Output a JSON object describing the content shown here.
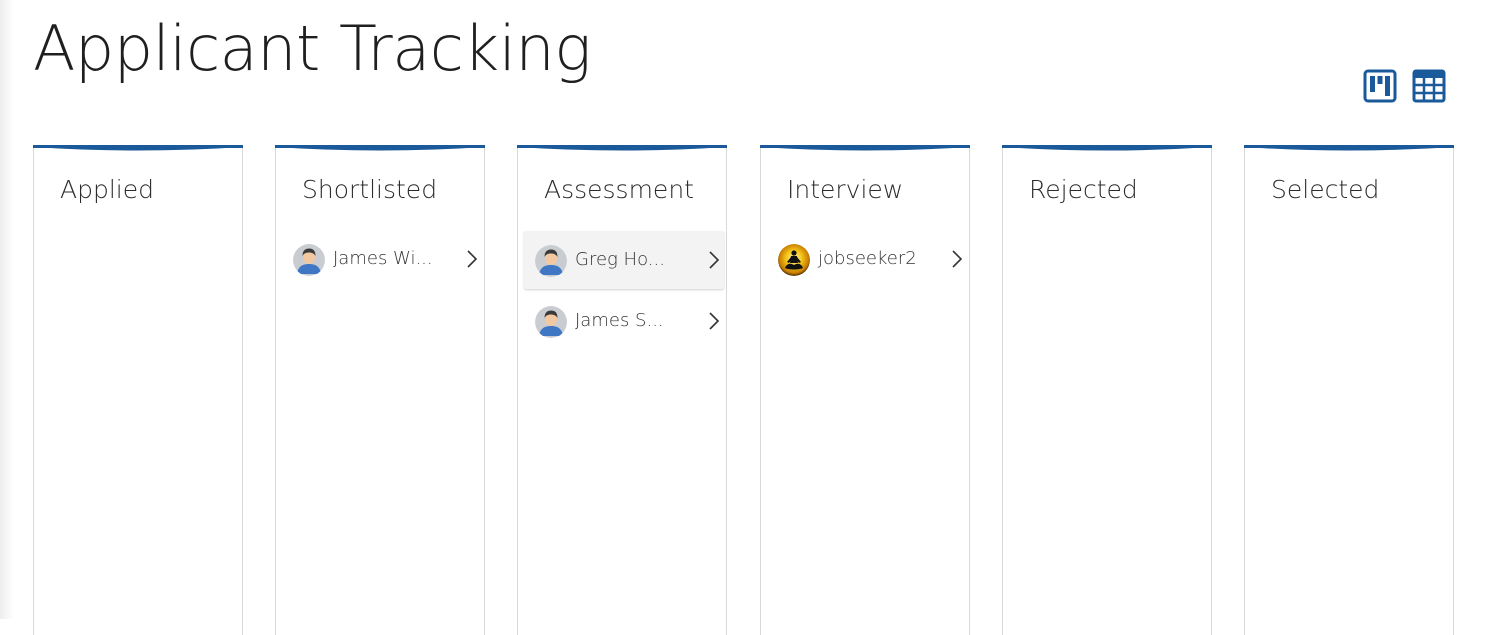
{
  "page": {
    "title": "Applicant Tracking"
  },
  "view_toggles": {
    "kanban_icon": "kanban-board-icon",
    "table_icon": "table-grid-icon",
    "accent_color": "#1a5a9a"
  },
  "board": {
    "accent_color": "#1a5a9a",
    "columns": [
      {
        "header": "Applied",
        "cards": []
      },
      {
        "header": "Shortlisted",
        "cards": [
          {
            "name": "James Wi...",
            "avatar": "default-male-avatar"
          }
        ]
      },
      {
        "header": "Assessment",
        "cards": [
          {
            "name": "Greg Ho...",
            "avatar": "default-male-avatar",
            "highlighted": true
          },
          {
            "name": "James S...",
            "avatar": "default-male-avatar"
          }
        ]
      },
      {
        "header": "Interview",
        "cards": [
          {
            "name": "jobseeker2",
            "avatar": "meditation-silhouette-avatar"
          }
        ]
      },
      {
        "header": "Rejected",
        "cards": []
      },
      {
        "header": "Selected",
        "cards": []
      }
    ]
  }
}
